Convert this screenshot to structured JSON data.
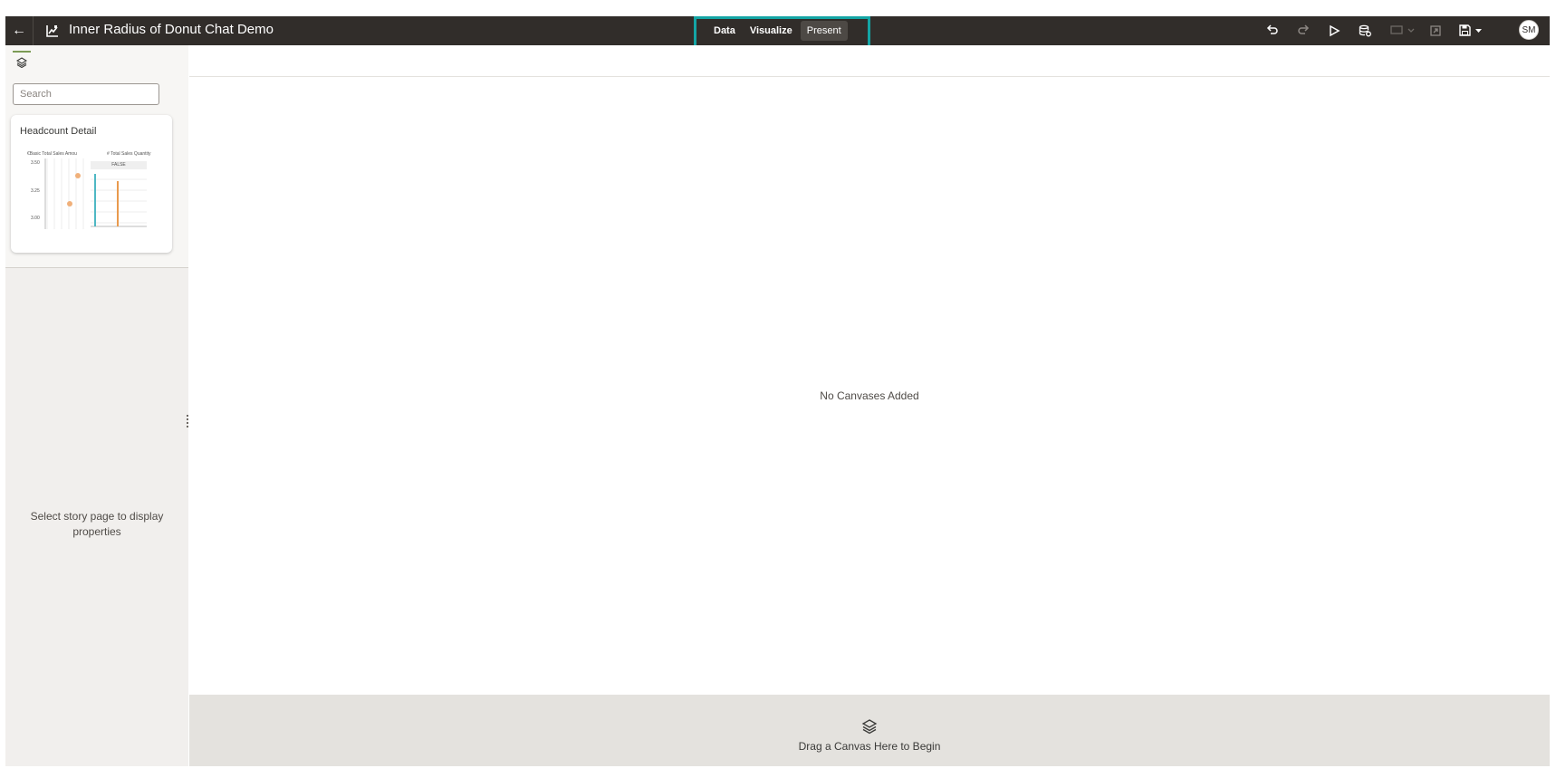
{
  "header": {
    "title": "Inner Radius of Donut Chat Demo",
    "modes": [
      {
        "label": "Data",
        "active": false
      },
      {
        "label": "Visualize",
        "active": false
      },
      {
        "label": "Present",
        "active": true
      }
    ],
    "user_initials": "SM",
    "icons": [
      "back-arrow-icon",
      "chart-icon",
      "undo-icon",
      "redo-icon",
      "play-icon",
      "data-refresh-icon",
      "comment-icon",
      "export-icon",
      "save-icon",
      "avatar"
    ]
  },
  "left_panel": {
    "search_placeholder": "Search",
    "card": {
      "title": "Headcount Detail",
      "chart_left_label": "€Basic Total Sales Amou",
      "chart_right_label": "# Total Sales Quantity",
      "chart_right_header": "FALSE",
      "y_ticks": [
        "3.50",
        "3.25",
        "3.00"
      ]
    },
    "properties_message": "Select story page to display properties"
  },
  "main": {
    "empty_message": "No Canvases Added",
    "drop_message": "Drag a Canvas Here to Begin"
  },
  "colors": {
    "topbar": "#312d2a",
    "highlight": "#14a5a5",
    "accent_green": "#7c9b55",
    "point_orange": "#f0b07a",
    "bar_teal": "#4fb8c4",
    "bar_orange": "#e99a4d"
  }
}
